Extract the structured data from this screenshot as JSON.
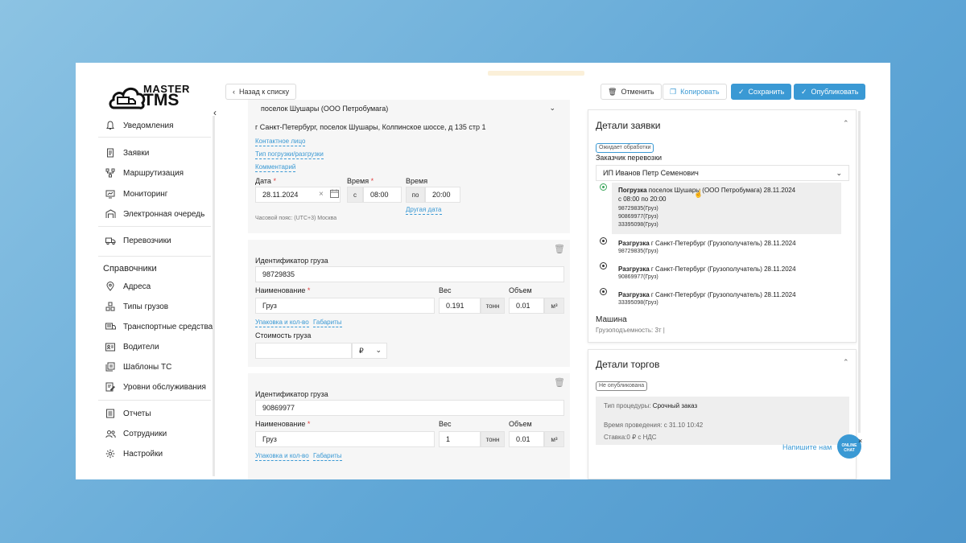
{
  "logo": {
    "line1": "MASTER",
    "line2": "TMS"
  },
  "nav": {
    "notifications": "Уведомления",
    "orders": "Заявки",
    "routing": "Маршрутизация",
    "monitoring": "Мониторинг",
    "queue": "Электронная очередь",
    "carriers": "Перевозчики",
    "directories_heading": "Справочники",
    "addresses": "Адреса",
    "cargo_types": "Типы грузов",
    "vehicles": "Транспортные средства",
    "drivers": "Водители",
    "vehicle_templates": "Шаблоны ТС",
    "service_levels": "Уровни обслуживания",
    "reports": "Отчеты",
    "employees": "Сотрудники",
    "settings": "Настройки"
  },
  "toolbar": {
    "back": "Назад к списку",
    "cancel": "Отменить",
    "copy": "Копировать",
    "save": "Сохранить",
    "publish": "Опубликовать"
  },
  "point": {
    "select_value": "поселок Шушары (ООО Петробумага)",
    "address": "г Санкт-Петербург, поселок Шушары, Колпинское шоссе, д 135 стр 1",
    "contact_link": "Контактное лицо",
    "loading_type_link": "Тип погрузки/разгрузки",
    "comment_link": "Комментарий",
    "date_label": "Дата",
    "time_label": "Время",
    "time_label2": "Время",
    "date_value": "28.11.2024",
    "from_prefix": "с",
    "from_value": "08:00",
    "to_prefix": "по",
    "to_value": "20:00",
    "other_date_link": "Другая дата",
    "timezone": "Часовой пояс: (UTC+3) Москва"
  },
  "cargo1": {
    "id_label": "Идентификатор груза",
    "id_value": "98729835",
    "name_label": "Наименование",
    "name_value": "Груз",
    "weight_label": "Вес",
    "weight_value": "0.191",
    "weight_unit": "тонн",
    "volume_label": "Объем",
    "volume_value": "0.01",
    "volume_unit": "м³",
    "packaging_link": "Упаковка и кол-во",
    "dimensions_link": "Габариты",
    "cost_label": "Стоимость груза",
    "currency": "₽"
  },
  "cargo2": {
    "id_label": "Идентификатор груза",
    "id_value": "90869977",
    "name_label": "Наименование",
    "name_value": "Груз",
    "weight_label": "Вес",
    "weight_value": "1",
    "weight_unit": "тонн",
    "volume_label": "Объем",
    "volume_value": "0.01",
    "volume_unit": "м³",
    "packaging_link": "Упаковка и кол-во",
    "dimensions_link": "Габариты"
  },
  "details": {
    "title": "Детали заявки",
    "status": "Ожидает обработки",
    "customer_label": "Заказчик перевозки",
    "customer_value": "ИП Иванов Петр Семенович",
    "stops": [
      {
        "type": "Погрузка",
        "place": "поселок Шушары (ООО Петробумага) 28.11.2024",
        "time": "с 08:00 по 20:00",
        "cargo": [
          "98729835(Груз)",
          "90869977(Груз)",
          "33395098(Груз)"
        ]
      },
      {
        "type": "Разгрузка",
        "place": "г Санкт-Петербург (Грузополучатель) 28.11.2024",
        "cargo": [
          "98729835(Груз)"
        ]
      },
      {
        "type": "Разгрузка",
        "place": "г Санкт-Петербург (Грузополучатель) 28.11.2024",
        "cargo": [
          "90869977(Груз)"
        ]
      },
      {
        "type": "Разгрузка",
        "place": "г Санкт-Петербург (Грузополучатель) 28.11.2024",
        "cargo": [
          "33395098(Груз)"
        ]
      }
    ],
    "vehicle_title": "Машина",
    "capacity": "Грузоподъемность: 3т |"
  },
  "trade": {
    "title": "Детали торгов",
    "status": "Не опубликована",
    "procedure_label": "Тип процедуры:",
    "procedure_value": "Срочный заказ",
    "time": "Время проведения: с 31.10 10:42",
    "rate": "Ставка:0 ₽ с НДС"
  },
  "chat": {
    "text": "Напишите нам",
    "badge": "ONLINE CHAT"
  },
  "colors": {
    "accent": "#3a99d4",
    "required": "#e04040",
    "active_stop": "#3aa55a"
  }
}
